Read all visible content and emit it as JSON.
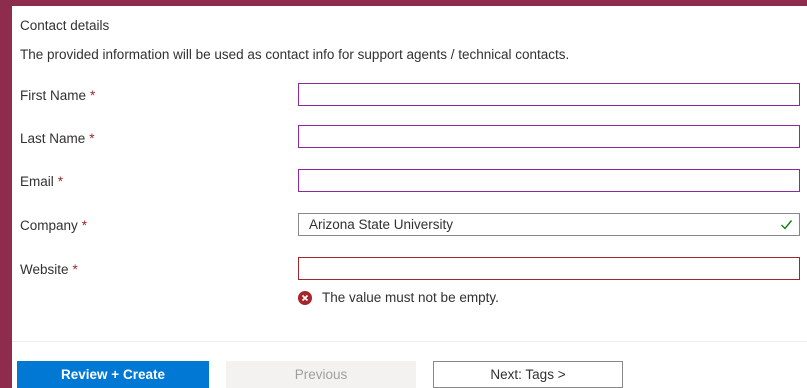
{
  "section": {
    "title": "Contact details",
    "description": "The provided information will be used as contact info for support agents / technical contacts."
  },
  "required_marker": "*",
  "fields": [
    {
      "label": "First Name",
      "value": "",
      "state": "focused"
    },
    {
      "label": "Last Name",
      "value": "",
      "state": "focused"
    },
    {
      "label": "Email",
      "value": "",
      "state": "focused"
    },
    {
      "label": "Company",
      "value": "Arizona State University",
      "state": "valid"
    },
    {
      "label": "Website",
      "value": "",
      "state": "error"
    }
  ],
  "validation": {
    "website_error": "The value must not be empty."
  },
  "buttons": {
    "review_create": "Review + Create",
    "previous": "Previous",
    "next": "Next: Tags >"
  },
  "colors": {
    "frame": "#8e2c4e",
    "primary": "#0078d4",
    "error": "#a4262c",
    "success": "#107c10"
  }
}
